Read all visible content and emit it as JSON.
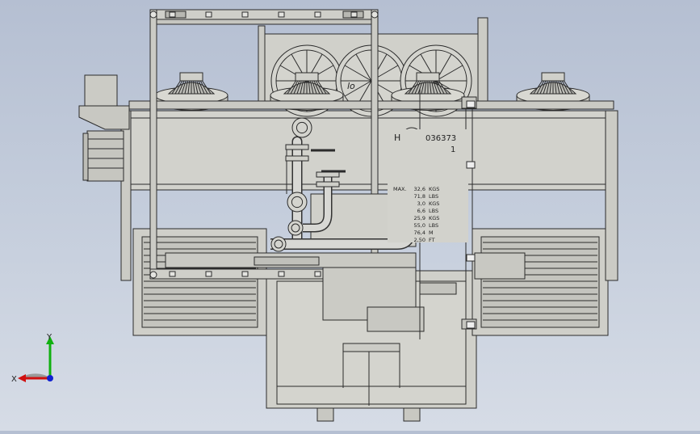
{
  "viewport": {
    "label": "graphics-area",
    "background_top": "#b5bfd2",
    "background_bottom": "#d6dce6",
    "line_color": "#2b2b2b",
    "body_fill": "#d2d2cc"
  },
  "model": {
    "plate_word": "MAX.",
    "plate_prefix": "H",
    "plate_serial": "036373",
    "plate_digit": "1",
    "brand_fragment": "lo",
    "plate_rows": [
      {
        "value": "32,6",
        "unit": "KGS"
      },
      {
        "value": "71,8",
        "unit": "LBS"
      },
      {
        "value": "3,0",
        "unit": "KGS"
      },
      {
        "value": "6,6",
        "unit": "LBS"
      },
      {
        "value": "25,9",
        "unit": "KGS"
      },
      {
        "value": "55,0",
        "unit": "LBS"
      },
      {
        "value": "76,4",
        "unit": "M"
      },
      {
        "value": "2,50",
        "unit": "FT"
      }
    ]
  },
  "triad": {
    "x_label": "X",
    "y_label": "Y",
    "x_color": "#d01010",
    "y_color": "#10b010",
    "z_color": "#1020d0"
  }
}
